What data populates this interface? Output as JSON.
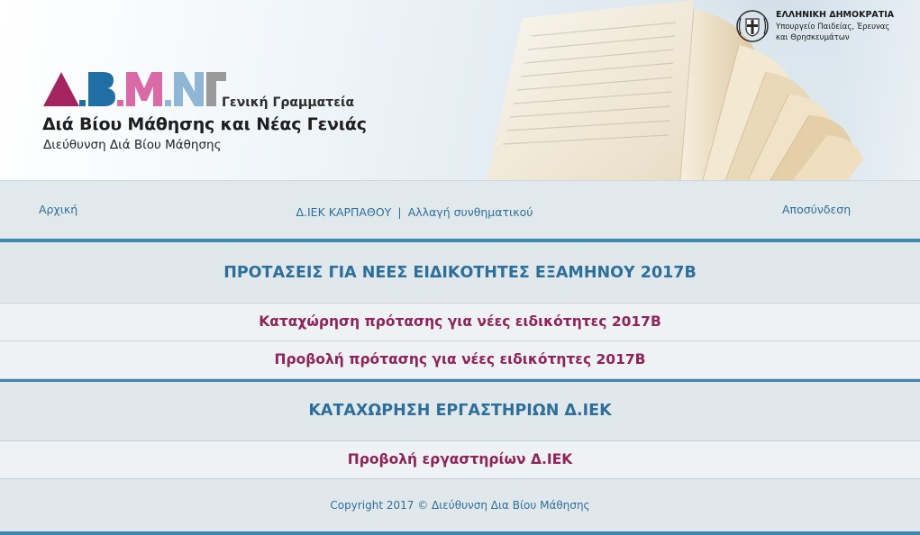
{
  "header": {
    "logo_text": "Δ.Β.Μ.Ν.Γ",
    "general_secretariat": "Γενική Γραμματεία",
    "title": "Διά Βίου Μάθησης και Νέας Γενιάς",
    "subtitle": "Διεύθυνση Διά Βίου Μάθησης",
    "gov": {
      "title": "ΕΛΛΗΝΙΚΗ ΔΗΜΟΚΡΑΤΙΑ",
      "line1": "Υπουργείο Παιδείας, Έρευνας",
      "line2": "και Θρησκευμάτων",
      "emblem_icon": "greek-coat-of-arms-icon"
    },
    "colors": {
      "logo_magenta": "#a3245f",
      "logo_blue": "#1f6fa4",
      "logo_pink": "#d96aa6",
      "logo_lightblue": "#8fb6d4",
      "logo_gray": "#9a9a9a"
    }
  },
  "nav": {
    "home": "Αρχική",
    "school": "Δ.ΙΕΚ ΚΑΡΠΑΘΟΥ",
    "separator": "|",
    "change_password": "Αλλαγή συνθηματικού",
    "logout": "Αποσύνδεση"
  },
  "sections": [
    {
      "heading": "ΠΡΟΤΑΣΕΙΣ ΓΙΑ ΝΕΕΣ ΕΙΔΙΚΟΤΗΤΕΣ ΕΞΑΜΗΝΟΥ 2017Β",
      "items": [
        "Καταχώρηση πρότασης για νέες ειδικότητες 2017Β",
        "Προβολή πρότασης για νέες ειδικότητες 2017Β"
      ]
    },
    {
      "heading": "ΚΑΤΑΧΩΡΗΣΗ ΕΡΓΑΣΤΗΡΙΩΝ Δ.ΙΕΚ",
      "items": [
        "Προβολή εργαστηρίων Δ.ΙΕΚ"
      ]
    }
  ],
  "footer": {
    "copyright": "Copyright 2017 © Διεύθυνση Δια Βίου Μάθησης"
  },
  "theme": {
    "accent": "#3f86b0",
    "link": "#2e6f99",
    "item_text": "#8e2459",
    "heading_text": "#2d6f99"
  }
}
